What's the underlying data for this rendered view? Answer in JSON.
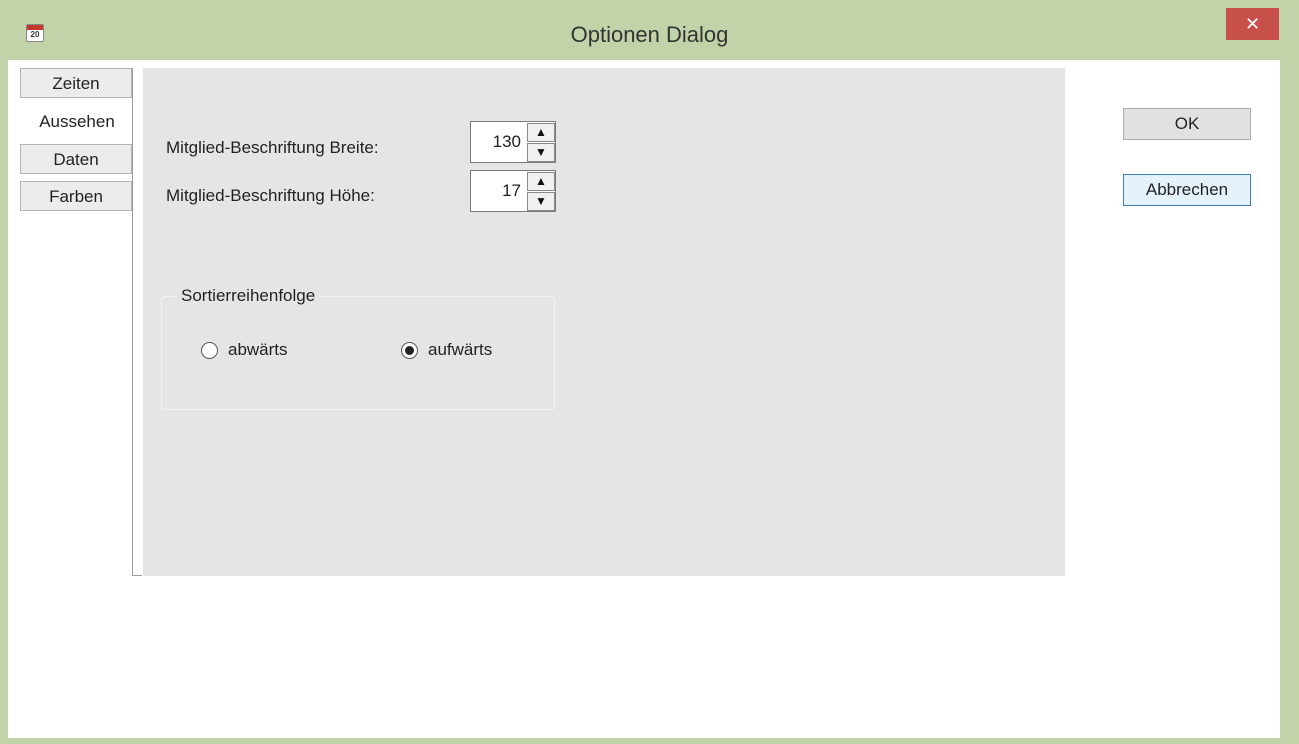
{
  "window": {
    "title": "Optionen Dialog",
    "icon": "calendar-icon",
    "icon_text": "20",
    "close_glyph": "✕",
    "close_color": "#c7504b",
    "frame_color": "#c3d3a9"
  },
  "tabs": [
    {
      "label": "Zeiten",
      "active": false
    },
    {
      "label": "Aussehen",
      "active": true
    },
    {
      "label": "Daten",
      "active": false
    },
    {
      "label": "Farben",
      "active": false
    }
  ],
  "appearance": {
    "width_label": "Mitglied-Beschriftung Breite:",
    "width_value": "130",
    "height_label": "Mitglied-Beschriftung Höhe:",
    "height_value": "17",
    "sort_group_title": "Sortierreihenfolge",
    "sort_options": [
      {
        "label": "abwärts",
        "selected": false
      },
      {
        "label": "aufwärts",
        "selected": true
      }
    ]
  },
  "buttons": {
    "ok_label": "OK",
    "cancel_label": "Abbrechen"
  }
}
